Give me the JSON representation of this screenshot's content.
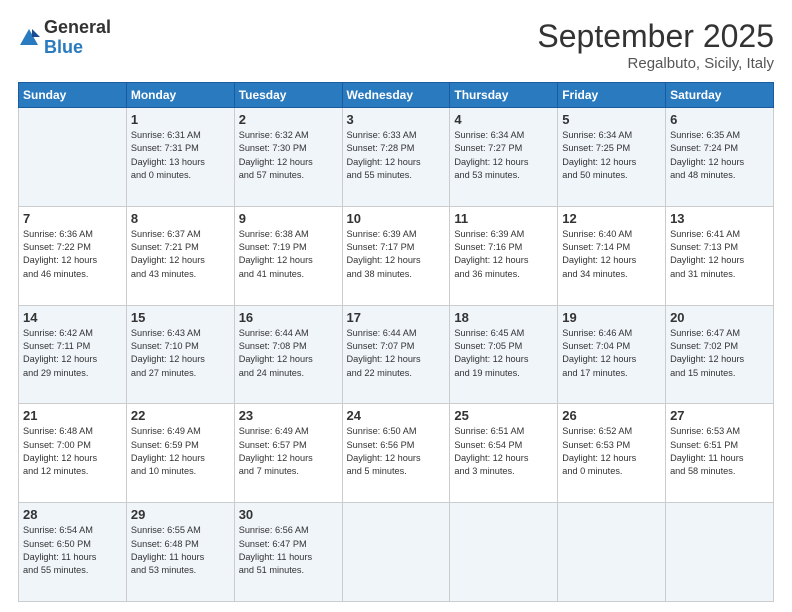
{
  "header": {
    "logo_general": "General",
    "logo_blue": "Blue",
    "title": "September 2025",
    "location": "Regalbuto, Sicily, Italy"
  },
  "days_of_week": [
    "Sunday",
    "Monday",
    "Tuesday",
    "Wednesday",
    "Thursday",
    "Friday",
    "Saturday"
  ],
  "weeks": [
    [
      {
        "day": "",
        "info": ""
      },
      {
        "day": "1",
        "info": "Sunrise: 6:31 AM\nSunset: 7:31 PM\nDaylight: 13 hours\nand 0 minutes."
      },
      {
        "day": "2",
        "info": "Sunrise: 6:32 AM\nSunset: 7:30 PM\nDaylight: 12 hours\nand 57 minutes."
      },
      {
        "day": "3",
        "info": "Sunrise: 6:33 AM\nSunset: 7:28 PM\nDaylight: 12 hours\nand 55 minutes."
      },
      {
        "day": "4",
        "info": "Sunrise: 6:34 AM\nSunset: 7:27 PM\nDaylight: 12 hours\nand 53 minutes."
      },
      {
        "day": "5",
        "info": "Sunrise: 6:34 AM\nSunset: 7:25 PM\nDaylight: 12 hours\nand 50 minutes."
      },
      {
        "day": "6",
        "info": "Sunrise: 6:35 AM\nSunset: 7:24 PM\nDaylight: 12 hours\nand 48 minutes."
      }
    ],
    [
      {
        "day": "7",
        "info": "Sunrise: 6:36 AM\nSunset: 7:22 PM\nDaylight: 12 hours\nand 46 minutes."
      },
      {
        "day": "8",
        "info": "Sunrise: 6:37 AM\nSunset: 7:21 PM\nDaylight: 12 hours\nand 43 minutes."
      },
      {
        "day": "9",
        "info": "Sunrise: 6:38 AM\nSunset: 7:19 PM\nDaylight: 12 hours\nand 41 minutes."
      },
      {
        "day": "10",
        "info": "Sunrise: 6:39 AM\nSunset: 7:17 PM\nDaylight: 12 hours\nand 38 minutes."
      },
      {
        "day": "11",
        "info": "Sunrise: 6:39 AM\nSunset: 7:16 PM\nDaylight: 12 hours\nand 36 minutes."
      },
      {
        "day": "12",
        "info": "Sunrise: 6:40 AM\nSunset: 7:14 PM\nDaylight: 12 hours\nand 34 minutes."
      },
      {
        "day": "13",
        "info": "Sunrise: 6:41 AM\nSunset: 7:13 PM\nDaylight: 12 hours\nand 31 minutes."
      }
    ],
    [
      {
        "day": "14",
        "info": "Sunrise: 6:42 AM\nSunset: 7:11 PM\nDaylight: 12 hours\nand 29 minutes."
      },
      {
        "day": "15",
        "info": "Sunrise: 6:43 AM\nSunset: 7:10 PM\nDaylight: 12 hours\nand 27 minutes."
      },
      {
        "day": "16",
        "info": "Sunrise: 6:44 AM\nSunset: 7:08 PM\nDaylight: 12 hours\nand 24 minutes."
      },
      {
        "day": "17",
        "info": "Sunrise: 6:44 AM\nSunset: 7:07 PM\nDaylight: 12 hours\nand 22 minutes."
      },
      {
        "day": "18",
        "info": "Sunrise: 6:45 AM\nSunset: 7:05 PM\nDaylight: 12 hours\nand 19 minutes."
      },
      {
        "day": "19",
        "info": "Sunrise: 6:46 AM\nSunset: 7:04 PM\nDaylight: 12 hours\nand 17 minutes."
      },
      {
        "day": "20",
        "info": "Sunrise: 6:47 AM\nSunset: 7:02 PM\nDaylight: 12 hours\nand 15 minutes."
      }
    ],
    [
      {
        "day": "21",
        "info": "Sunrise: 6:48 AM\nSunset: 7:00 PM\nDaylight: 12 hours\nand 12 minutes."
      },
      {
        "day": "22",
        "info": "Sunrise: 6:49 AM\nSunset: 6:59 PM\nDaylight: 12 hours\nand 10 minutes."
      },
      {
        "day": "23",
        "info": "Sunrise: 6:49 AM\nSunset: 6:57 PM\nDaylight: 12 hours\nand 7 minutes."
      },
      {
        "day": "24",
        "info": "Sunrise: 6:50 AM\nSunset: 6:56 PM\nDaylight: 12 hours\nand 5 minutes."
      },
      {
        "day": "25",
        "info": "Sunrise: 6:51 AM\nSunset: 6:54 PM\nDaylight: 12 hours\nand 3 minutes."
      },
      {
        "day": "26",
        "info": "Sunrise: 6:52 AM\nSunset: 6:53 PM\nDaylight: 12 hours\nand 0 minutes."
      },
      {
        "day": "27",
        "info": "Sunrise: 6:53 AM\nSunset: 6:51 PM\nDaylight: 11 hours\nand 58 minutes."
      }
    ],
    [
      {
        "day": "28",
        "info": "Sunrise: 6:54 AM\nSunset: 6:50 PM\nDaylight: 11 hours\nand 55 minutes."
      },
      {
        "day": "29",
        "info": "Sunrise: 6:55 AM\nSunset: 6:48 PM\nDaylight: 11 hours\nand 53 minutes."
      },
      {
        "day": "30",
        "info": "Sunrise: 6:56 AM\nSunset: 6:47 PM\nDaylight: 11 hours\nand 51 minutes."
      },
      {
        "day": "",
        "info": ""
      },
      {
        "day": "",
        "info": ""
      },
      {
        "day": "",
        "info": ""
      },
      {
        "day": "",
        "info": ""
      }
    ]
  ]
}
